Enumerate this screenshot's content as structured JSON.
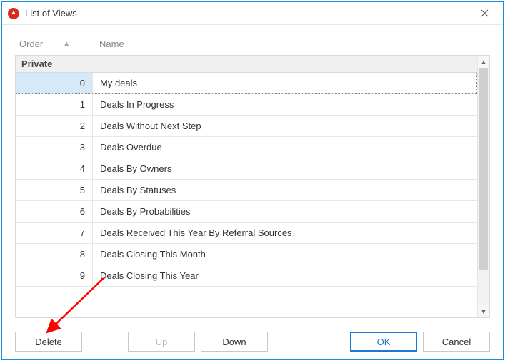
{
  "window": {
    "title": "List of Views"
  },
  "columns": {
    "order": "Order",
    "name": "Name"
  },
  "group": {
    "label": "Private"
  },
  "rows": [
    {
      "order": "0",
      "name": "My deals",
      "selected": true
    },
    {
      "order": "1",
      "name": "Deals In Progress"
    },
    {
      "order": "2",
      "name": "Deals Without Next Step"
    },
    {
      "order": "3",
      "name": "Deals Overdue"
    },
    {
      "order": "4",
      "name": "Deals By Owners"
    },
    {
      "order": "5",
      "name": "Deals By Statuses"
    },
    {
      "order": "6",
      "name": "Deals By Probabilities"
    },
    {
      "order": "7",
      "name": "Deals Received This Year By Referral Sources"
    },
    {
      "order": "8",
      "name": "Deals Closing This Month"
    },
    {
      "order": "9",
      "name": "Deals Closing This Year"
    }
  ],
  "buttons": {
    "delete": "Delete",
    "up": "Up",
    "down": "Down",
    "ok": "OK",
    "cancel": "Cancel"
  },
  "annotation": {
    "arrow_color": "#ff0000"
  }
}
